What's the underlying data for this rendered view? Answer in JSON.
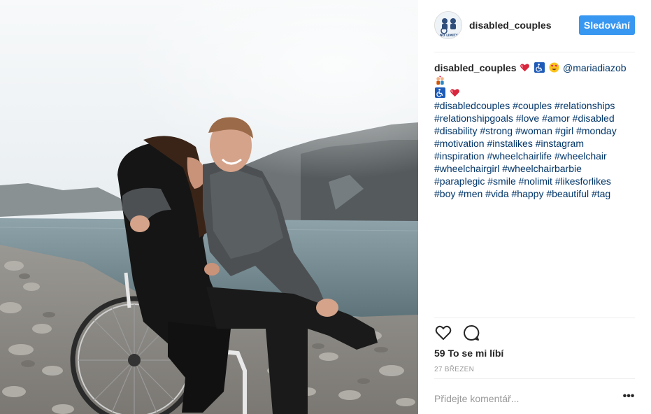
{
  "post": {
    "image_alt": "",
    "author": {
      "username": "disabled_couples",
      "avatar_text": "NO LIMITS"
    },
    "follow_label": "Sledování",
    "caption": {
      "username": "disabled_couples",
      "mention": "@mariadiazob",
      "hashtag_lines": [
        "#disabledcouples #couples #relationships",
        "#relationshipgoals #love #amor #disabled",
        "#disability #strong #woman #girl #monday",
        "#motivation #instalikes #instagram",
        "#inspiration #wheelchairlife #wheelchair",
        "#wheelchairgirl #wheelchairbarbie",
        "#paraplegic #smile #nolimit #likesforlikes",
        "#boy #men #vida #happy #beautiful #tag"
      ]
    },
    "likes_text": "59 To se mi líbí",
    "date_text": "27 BŘEZEN",
    "comment_placeholder": "Přidejte komentář...",
    "more_label": "•••"
  },
  "icons": {
    "like": "heart-icon",
    "comment": "comment-icon",
    "heart_emoji": "two-hearts-emoji",
    "wheelchair_emoji": "wheelchair-symbol-emoji",
    "heart_eyes_emoji": "heart-eyes-emoji",
    "couple_emoji": "couple-with-heart-emoji"
  },
  "colors": {
    "follow_button": "#3897f0",
    "hashtag": "#003569",
    "muted": "#999999",
    "divider": "#efefef"
  }
}
